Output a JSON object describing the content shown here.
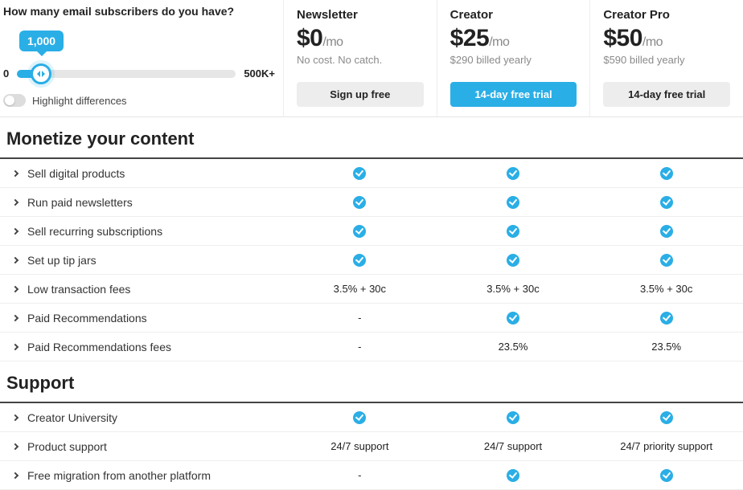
{
  "question": {
    "title": "How many email subscribers do you have?",
    "value": "1,000",
    "slider_min": "0",
    "slider_max": "500K+",
    "toggle_label": "Highlight differences"
  },
  "plans": [
    {
      "name": "Newsletter",
      "price": "$0",
      "suffix": "/mo",
      "sub": "No cost. No catch.",
      "cta": "Sign up free",
      "cta_style": "grey"
    },
    {
      "name": "Creator",
      "price": "$25",
      "suffix": "/mo",
      "sub": "$290 billed yearly",
      "cta": "14-day free trial",
      "cta_style": "blue"
    },
    {
      "name": "Creator Pro",
      "price": "$50",
      "suffix": "/mo",
      "sub": "$590 billed yearly",
      "cta": "14-day free trial",
      "cta_style": "grey"
    }
  ],
  "sections": [
    {
      "title": "Monetize your content",
      "rows": [
        {
          "label": "Sell digital products",
          "cells": [
            "check",
            "check",
            "check"
          ]
        },
        {
          "label": "Run paid newsletters",
          "cells": [
            "check",
            "check",
            "check"
          ]
        },
        {
          "label": "Sell recurring subscriptions",
          "cells": [
            "check",
            "check",
            "check"
          ]
        },
        {
          "label": "Set up tip jars",
          "cells": [
            "check",
            "check",
            "check"
          ]
        },
        {
          "label": "Low transaction fees",
          "cells": [
            "3.5% + 30c",
            "3.5% + 30c",
            "3.5% + 30c"
          ]
        },
        {
          "label": "Paid Recommendations",
          "cells": [
            "-",
            "check",
            "check"
          ]
        },
        {
          "label": "Paid Recommendations fees",
          "cells": [
            "-",
            "23.5%",
            "23.5%"
          ]
        }
      ]
    },
    {
      "title": "Support",
      "rows": [
        {
          "label": "Creator University",
          "cells": [
            "check",
            "check",
            "check"
          ]
        },
        {
          "label": "Product support",
          "cells": [
            "24/7 support",
            "24/7 support",
            "24/7 priority support"
          ]
        },
        {
          "label": "Free migration from another platform",
          "cells": [
            "-",
            "check",
            "check"
          ]
        }
      ]
    }
  ]
}
